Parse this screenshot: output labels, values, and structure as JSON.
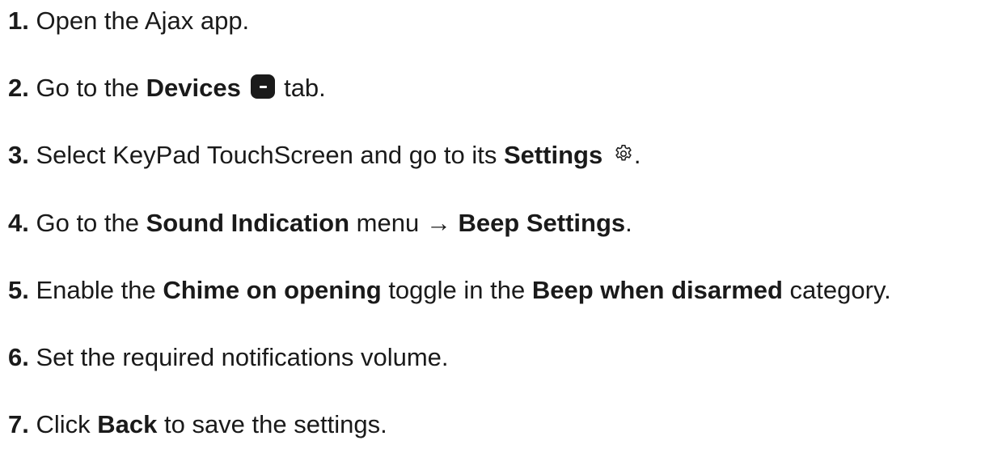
{
  "steps": [
    {
      "num": "1.",
      "t1": " Open the Ajax app."
    },
    {
      "num": "2.",
      "t1": " Go to the ",
      "b1": "Devices",
      "icon": "devices-icon",
      "t2": " tab."
    },
    {
      "num": "3.",
      "t1": " Select KeyPad TouchScreen and go to its ",
      "b1": "Settings",
      "icon": "gear-icon",
      "t2": "."
    },
    {
      "num": "4.",
      "t1": " Go to the ",
      "b1": "Sound Indication",
      "t2": " menu → ",
      "b2": "Beep Settings",
      "t3": "."
    },
    {
      "num": "5.",
      "t1": " Enable the ",
      "b1": "Chime on opening",
      "t2": " toggle in the ",
      "b2": "Beep when disarmed",
      "t3": " category."
    },
    {
      "num": "6.",
      "t1": " Set the required notifications volume."
    },
    {
      "num": "7.",
      "t1": " Click ",
      "b1": "Back",
      "t2": " to save the settings."
    }
  ]
}
